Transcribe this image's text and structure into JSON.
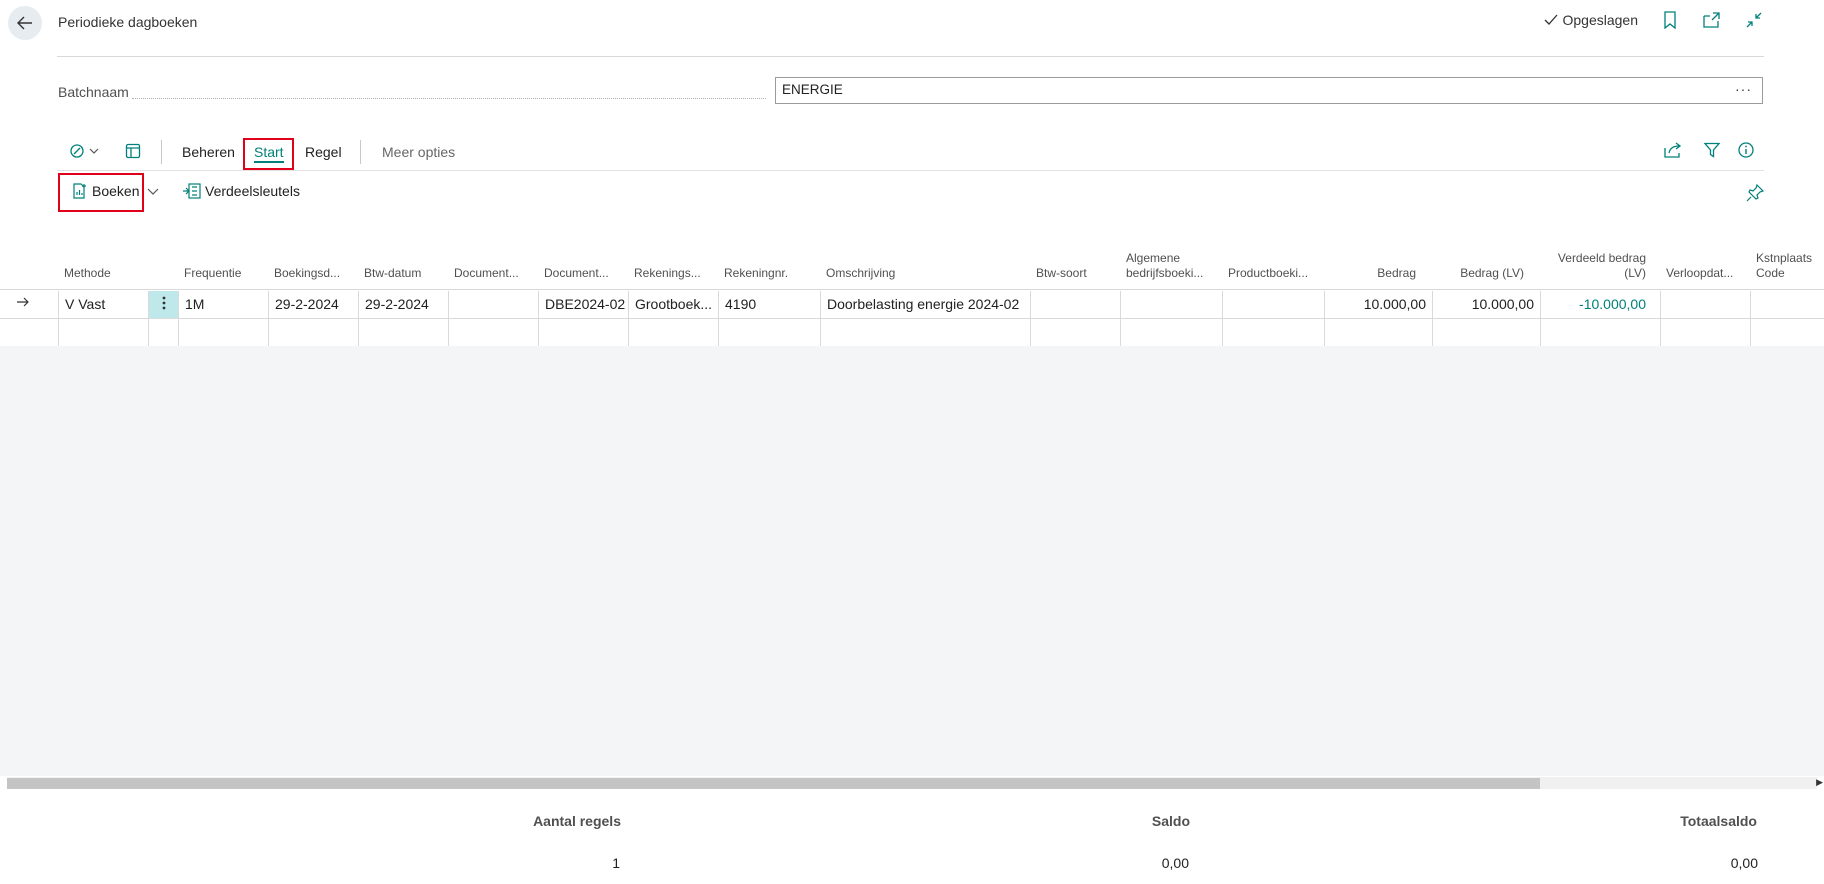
{
  "header": {
    "title": "Periodieke dagboeken",
    "saved_label": "Opgeslagen"
  },
  "batch": {
    "label": "Batchnaam",
    "value": "ENERGIE",
    "lookup": "···"
  },
  "actions": {
    "manage": "Beheren",
    "start": "Start",
    "line": "Regel",
    "more": "Meer opties"
  },
  "subactions": {
    "post": "Boeken",
    "allocation_keys": "Verdeelsleutels"
  },
  "columns": {
    "methode": "Methode",
    "frequentie": "Frequentie",
    "boekingsdatum": "Boekingsd...",
    "btw_datum": "Btw-datum",
    "document1": "Document...",
    "document2": "Document...",
    "rekeningsoort": "Rekenings...",
    "rekeningnr": "Rekeningnr.",
    "omschrijving": "Omschrijving",
    "btw_soort": "Btw-soort",
    "algemene_1": "Algemene",
    "algemene_2": "bedrijfsboeki...",
    "productboeking": "Productboeki...",
    "bedrag": "Bedrag",
    "bedrag_lv": "Bedrag (LV)",
    "verdeeld_1": "Verdeeld bedrag",
    "verdeeld_2": "(LV)",
    "verloopdatum": "Verloopdat...",
    "kst_1": "Kstnplaats",
    "kst_2": "Code"
  },
  "rows": [
    {
      "methode": "V Vast",
      "frequentie": "1M",
      "boekingsdatum": "29-2-2024",
      "btw_datum": "29-2-2024",
      "document1": "",
      "document2": "DBE2024-02",
      "rekeningsoort": "Grootboek...",
      "rekeningnr": "4190",
      "omschrijving": "Doorbelasting energie 2024-02",
      "bedrag": "10.000,00",
      "bedrag_lv": "10.000,00",
      "verdeeld": "-10.000,00"
    }
  ],
  "totals": {
    "lines_label": "Aantal regels",
    "lines_value": "1",
    "balance_label": "Saldo",
    "balance_value": "0,00",
    "total_label": "Totaalsaldo",
    "total_value": "0,00"
  },
  "colors": {
    "accent": "#00807a",
    "highlight": "#e0001a",
    "row_menu": "#bfe8ea"
  }
}
